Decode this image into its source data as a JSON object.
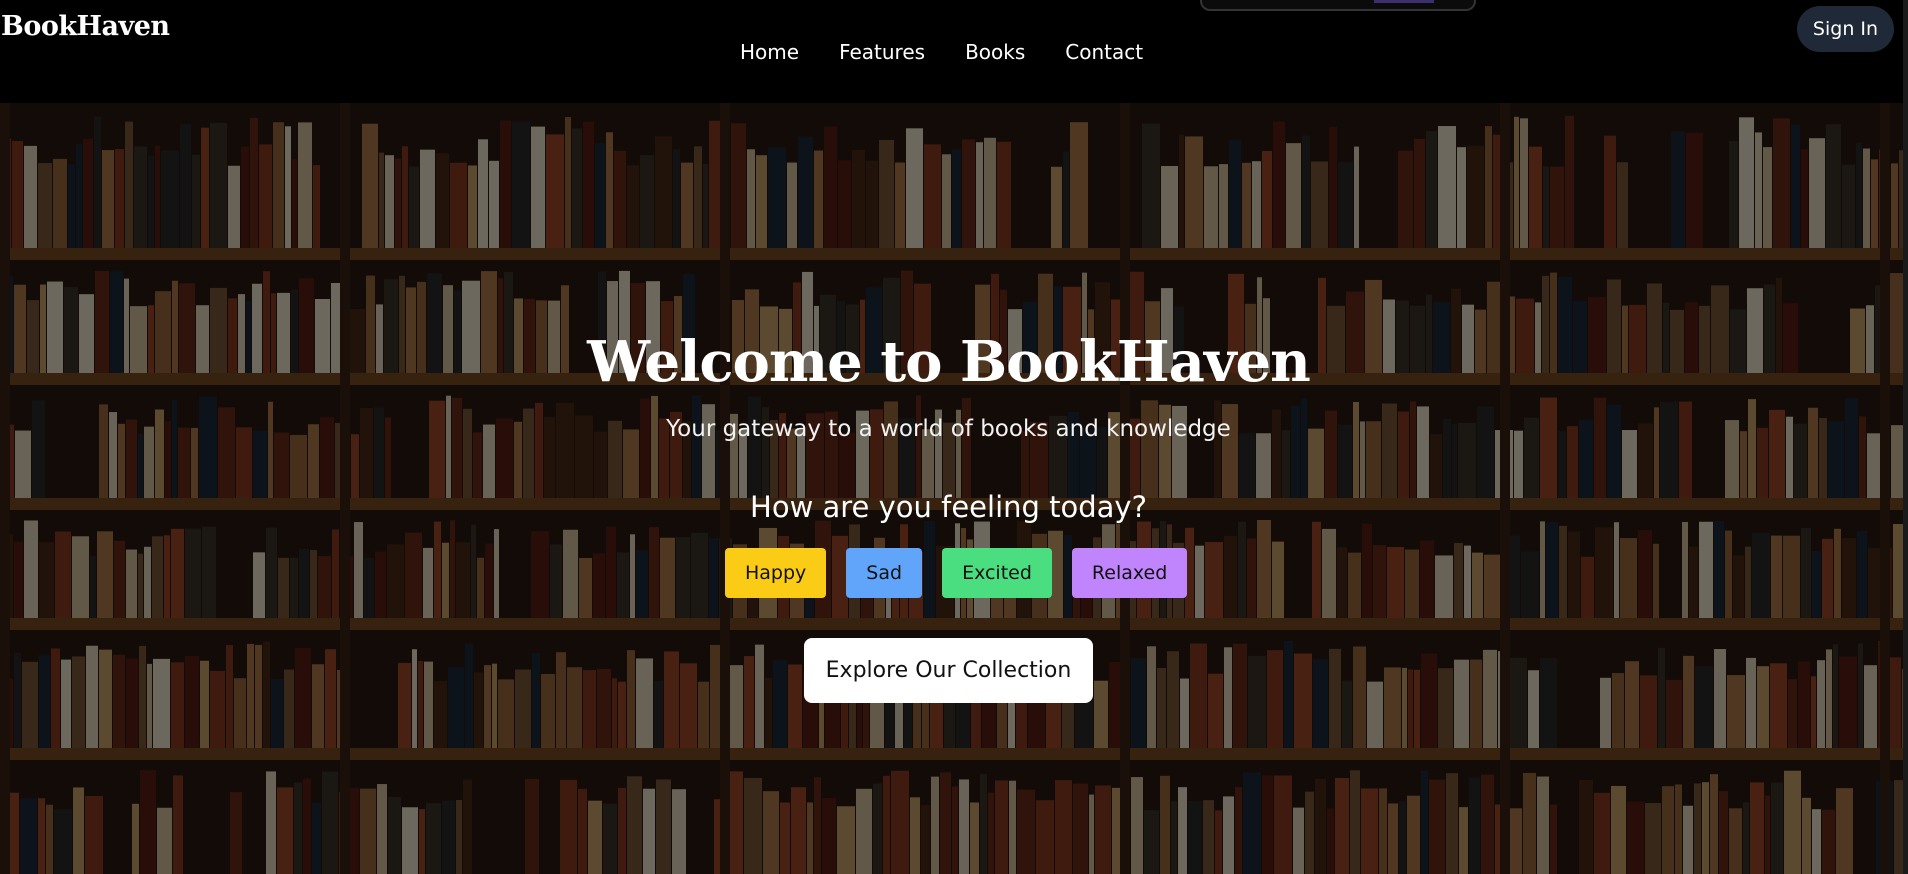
{
  "header": {
    "brand": "BookHaven",
    "nav": [
      "Home",
      "Features",
      "Books",
      "Contact"
    ],
    "signin_label": "Sign In"
  },
  "hero": {
    "title": "Welcome to BookHaven",
    "subtitle": "Your gateway to a world of books and knowledge",
    "question": "How are you feeling today?",
    "moods": [
      {
        "label": "Happy",
        "color": "#facc15"
      },
      {
        "label": "Sad",
        "color": "#60a5fa"
      },
      {
        "label": "Excited",
        "color": "#4ade80"
      },
      {
        "label": "Relaxed",
        "color": "#c084fc"
      }
    ],
    "cta_label": "Explore Our Collection"
  },
  "colors": {
    "header_bg": "#000000",
    "signin_bg": "#1f2937"
  }
}
